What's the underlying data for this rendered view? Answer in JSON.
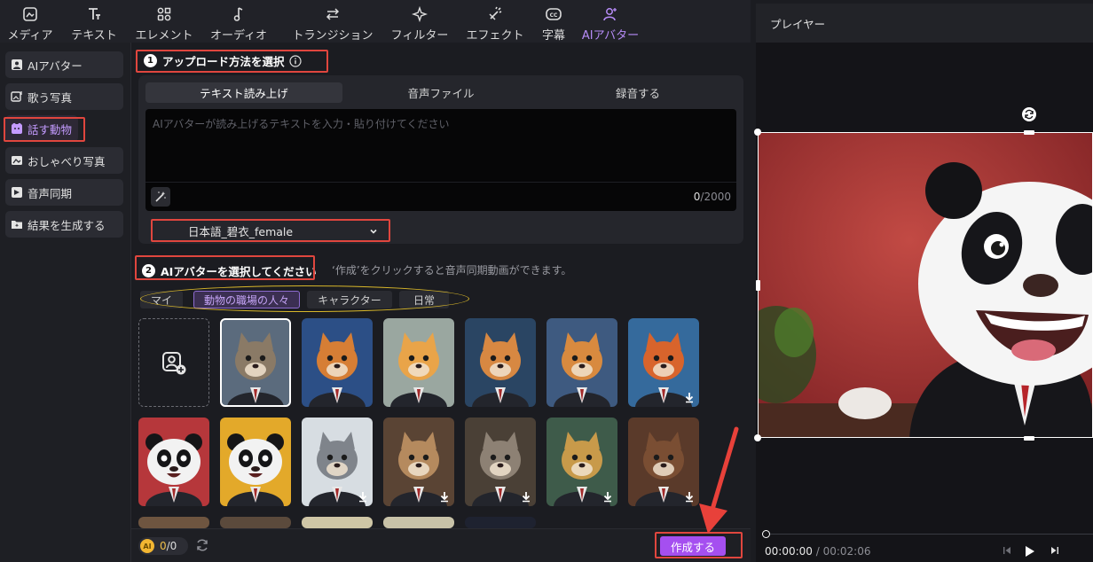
{
  "toolbar": {
    "items": [
      {
        "label": "メディア",
        "icon": "media-icon"
      },
      {
        "label": "テキスト",
        "icon": "text-icon"
      },
      {
        "label": "エレメント",
        "icon": "element-icon"
      },
      {
        "label": "オーディオ",
        "icon": "audio-icon"
      },
      {
        "label": "トランジション",
        "icon": "transition-icon"
      },
      {
        "label": "フィルター",
        "icon": "filter-icon"
      },
      {
        "label": "エフェクト",
        "icon": "effect-icon"
      },
      {
        "label": "字幕",
        "icon": "caption-icon"
      },
      {
        "label": "AIアバター",
        "icon": "ai-avatar-icon",
        "active": true
      }
    ]
  },
  "sidebar": {
    "items": [
      {
        "label": "AIアバター",
        "icon": "avatar-icon"
      },
      {
        "label": "歌う写真",
        "icon": "singing-photo-icon"
      },
      {
        "label": "話す動物",
        "icon": "talking-animal-icon",
        "active": true
      },
      {
        "label": "おしゃべり写真",
        "icon": "talking-photo-icon"
      },
      {
        "label": "音声同期",
        "icon": "lipsync-icon"
      },
      {
        "label": "結果を生成する",
        "icon": "generate-result-icon"
      }
    ]
  },
  "step1": {
    "number": "1",
    "title": "アップロード方法を選択",
    "info_icon": "info-icon",
    "tabs": [
      "テキスト読み上げ",
      "音声ファイル",
      "録音する"
    ],
    "active_tab": 0,
    "text_placeholder": "AIアバターが読み上げるテキストを入力・貼り付けてください",
    "char_current": "0",
    "char_max": "/2000",
    "voice": "日本語_碧衣_female"
  },
  "step2": {
    "number": "2",
    "title": "AIアバターを選択してください",
    "hint": "‘作成’をクリックすると音声同期動画ができます。",
    "categories": [
      "マイ",
      "動物の職場の人々",
      "キャラクター",
      "日常"
    ],
    "active_category": 1
  },
  "avatars": [
    {
      "name": "cat-suit-avatar",
      "selected": true,
      "download": false,
      "bg": "#5b6b7d",
      "fur": "#8a7a66"
    },
    {
      "name": "orange-cat-avatar",
      "download": false,
      "bg": "#2c4f86",
      "fur": "#d67e35"
    },
    {
      "name": "cartoon-cat-avatar",
      "download": false,
      "bg": "#9aa7a0",
      "fur": "#e9a449"
    },
    {
      "name": "fox-anchor-avatar",
      "download": false,
      "bg": "#2a4563",
      "fur": "#d78842"
    },
    {
      "name": "shiba-news-avatar",
      "download": false,
      "bg": "#3e5a80",
      "fur": "#d88a3f"
    },
    {
      "name": "red-fox-avatar",
      "download": true,
      "bg": "#356a9c",
      "fur": "#d8642c"
    },
    {
      "name": "panda-red-avatar",
      "download": false,
      "bg": "#b6373b",
      "fur": "#f2f2f2"
    },
    {
      "name": "panda-yellow-avatar",
      "download": false,
      "bg": "#e3a92a",
      "fur": "#f2f2f2"
    },
    {
      "name": "raccoon-avatar",
      "download": true,
      "bg": "#d7dde2",
      "fur": "#7f848b"
    },
    {
      "name": "kangaroo-avatar",
      "download": true,
      "bg": "#5a4434",
      "fur": "#b58a5e"
    },
    {
      "name": "wolf-avatar",
      "download": true,
      "bg": "#4a4036",
      "fur": "#8d8174"
    },
    {
      "name": "leopard-avatar",
      "download": true,
      "bg": "#3e5b4a",
      "fur": "#c89a4a"
    },
    {
      "name": "bear-avatar",
      "download": true,
      "bg": "#5a3a2a",
      "fur": "#7a4e33"
    }
  ],
  "footer": {
    "credit_current": "0",
    "credit_total": "/0",
    "create_label": "作成する"
  },
  "player": {
    "title": "プレイヤー",
    "time_current": "00:00:00",
    "time_sep": " / ",
    "time_total": "00:02:06"
  }
}
